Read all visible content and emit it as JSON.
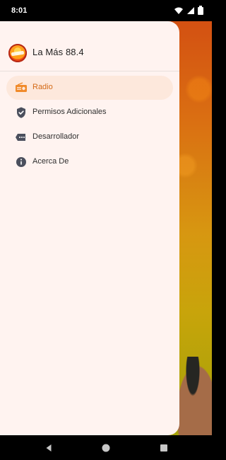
{
  "status_bar": {
    "time": "8:01",
    "icons": [
      "wifi-icon",
      "signal-icon",
      "battery-icon"
    ]
  },
  "drawer": {
    "title": "La Más 88.4",
    "items": [
      {
        "label": "Radio",
        "icon": "radio-icon",
        "active": true
      },
      {
        "label": "Permisos Adicionales",
        "icon": "shield-check-icon",
        "active": false
      },
      {
        "label": "Desarrollador",
        "icon": "developer-icon",
        "active": false
      },
      {
        "label": "Acerca De",
        "icon": "info-icon",
        "active": false
      }
    ]
  },
  "nav_bar": {
    "buttons": [
      "back-button",
      "home-button",
      "recents-button"
    ]
  },
  "colors": {
    "drawer_background": "#fff3f0",
    "active_item_background": "#fde8dc",
    "accent": "#d46a16",
    "status_bar": "#000000"
  }
}
